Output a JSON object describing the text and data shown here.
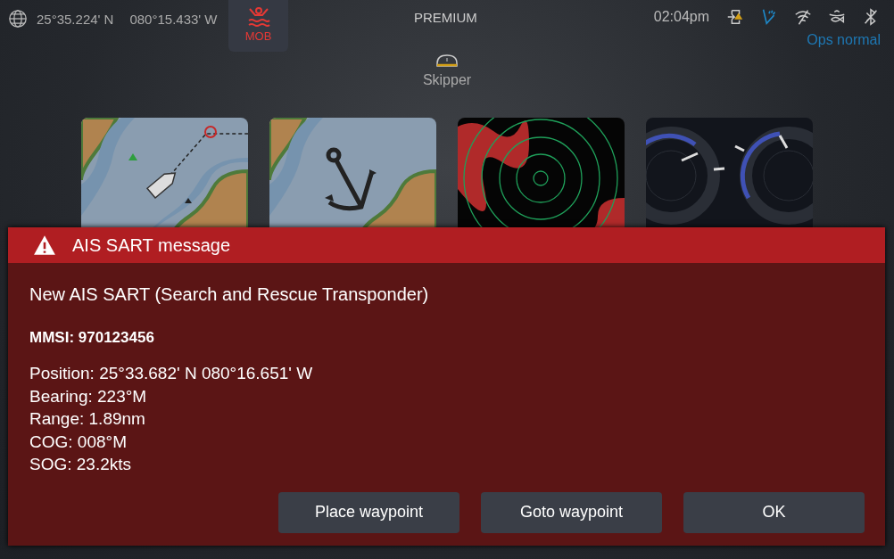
{
  "status_bar": {
    "latitude": "25°35.224' N",
    "longitude": "080°15.433' W",
    "mob_label": "MOB",
    "mode": "PREMIUM",
    "time": "02:04pm",
    "ops_status": "Ops normal"
  },
  "profile": {
    "label": "Skipper"
  },
  "tiles": [
    {
      "kind": "navigate"
    },
    {
      "kind": "anchor"
    },
    {
      "kind": "radar"
    },
    {
      "kind": "gauges"
    }
  ],
  "dialog": {
    "title": "AIS SART message",
    "heading": "New AIS SART (Search and Rescue Transponder)",
    "mmsi": "MMSI: 970123456",
    "details": [
      "Position: 25°33.682' N 080°16.651' W",
      "Bearing: 223°M",
      "Range: 1.89nm",
      "COG: 008°M",
      "SOG: 23.2kts"
    ],
    "buttons": [
      "Place waypoint",
      "Goto waypoint",
      "OK"
    ]
  }
}
